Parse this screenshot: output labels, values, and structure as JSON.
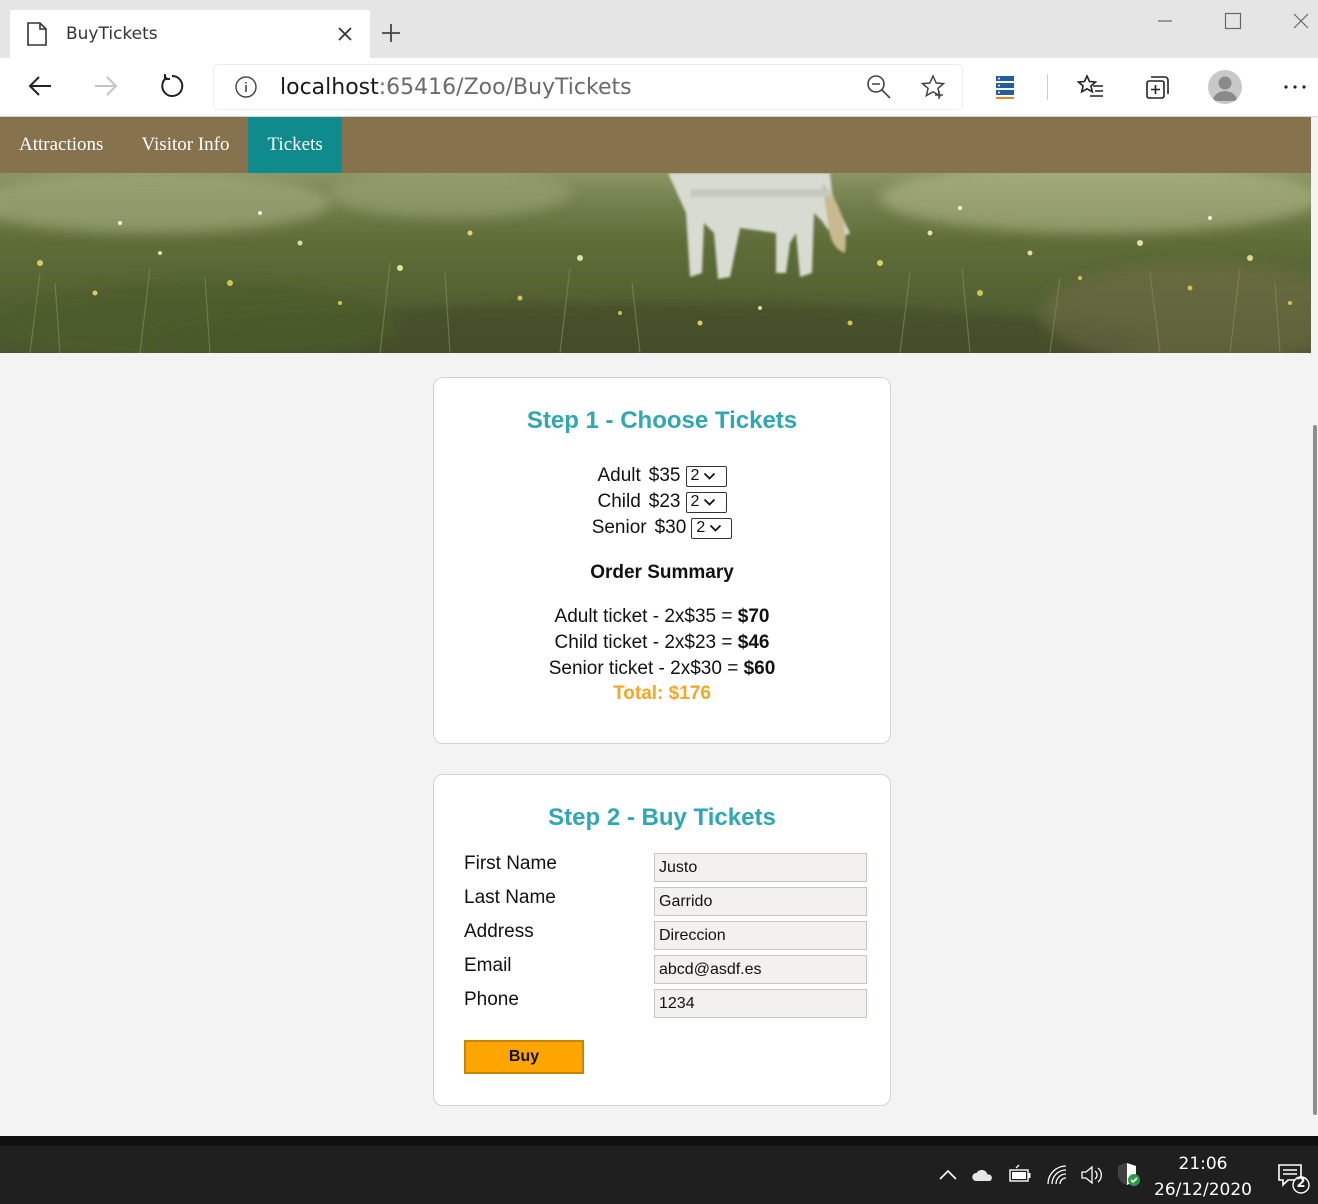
{
  "browser": {
    "tab_title": "BuyTickets",
    "url_host": "localhost",
    "url_path": ":65416/Zoo/BuyTickets",
    "icons": [
      "page-icon",
      "close-icon",
      "plus-icon",
      "back-icon",
      "forward-icon",
      "refresh-icon",
      "info-icon",
      "zoom-icon",
      "favorite-icon",
      "extension-icon",
      "favorites-list-icon",
      "collections-icon",
      "profile-icon",
      "more-icon",
      "minimize-icon",
      "maximize-icon",
      "window-close-icon"
    ]
  },
  "site_nav": {
    "items": [
      {
        "label": "Attractions",
        "active": false
      },
      {
        "label": "Visitor Info",
        "active": false
      },
      {
        "label": "Tickets",
        "active": true
      }
    ],
    "bg_color": "#86724d",
    "active_color": "#0f8b8d"
  },
  "step1": {
    "title": "Step 1 - Choose Tickets",
    "tickets": [
      {
        "label": "Adult",
        "price": "$35",
        "qty": "2"
      },
      {
        "label": "Child",
        "price": "$23",
        "qty": "2"
      },
      {
        "label": "Senior",
        "price": "$30",
        "qty": "2"
      }
    ],
    "summary_title": "Order Summary",
    "summary_lines": [
      {
        "text": "Adult ticket - 2x$35 = ",
        "amount": "$70"
      },
      {
        "text": "Child ticket - 2x$23 = ",
        "amount": "$46"
      },
      {
        "text": "Senior ticket - 2x$30 = ",
        "amount": "$60"
      }
    ],
    "total": "Total: $176",
    "heading_color": "#2fa7b4",
    "total_color": "#f5a623"
  },
  "step2": {
    "title": "Step 2 - Buy Tickets",
    "fields": [
      {
        "label": "First Name",
        "value": "Justo"
      },
      {
        "label": "Last Name",
        "value": "Garrido"
      },
      {
        "label": "Address",
        "value": "Direccion"
      },
      {
        "label": "Email",
        "value": "abcd@asdf.es"
      },
      {
        "label": "Phone",
        "value": "1234"
      }
    ],
    "buy_label": "Buy",
    "buy_color": "#ffa500"
  },
  "taskbar": {
    "time": "21:06",
    "date": "26/12/2020",
    "notification_count": "2",
    "icons": [
      "chevron-up-icon",
      "onedrive-icon",
      "battery-icon",
      "wifi-icon",
      "volume-icon",
      "security-icon",
      "notification-icon"
    ]
  }
}
